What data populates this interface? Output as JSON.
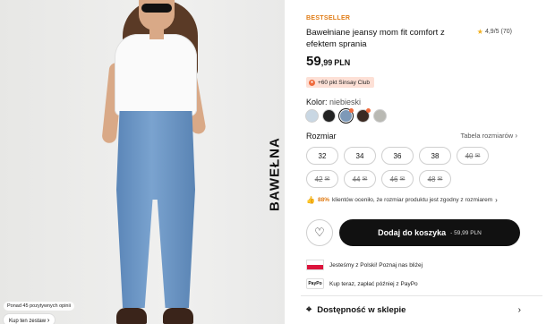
{
  "image": {
    "vertical_label": "BAWEŁNA",
    "reviews_note": "Ponad 45 pozytywnych opinii",
    "shop_look": "Kup ten zestaw",
    "shop_look_icon": "chevron-right-icon"
  },
  "product": {
    "badge": "BESTSELLER",
    "badge_color": "#e07b14",
    "title": "Bawełniane jeansy mom fit comfort z efektem sprania",
    "rating": "4,9/5",
    "rating_count": "(70)",
    "price_main": "59",
    "price_decimal": ",99",
    "currency": "PLN",
    "club_text": "+60 pkt Sinsay Club"
  },
  "color": {
    "label": "Kolor:",
    "value": "niebieski",
    "swatches": [
      {
        "name": "light-blue",
        "hex": "#c9d7e3",
        "selected": false,
        "dot": false
      },
      {
        "name": "black",
        "hex": "#222222",
        "selected": false,
        "dot": false
      },
      {
        "name": "blue",
        "hex": "#7d99b8",
        "selected": true,
        "dot": true
      },
      {
        "name": "dark-brown",
        "hex": "#3b2a22",
        "selected": false,
        "dot": true
      },
      {
        "name": "grey",
        "hex": "#b9b9b3",
        "selected": false,
        "dot": false
      }
    ]
  },
  "size": {
    "label": "Rozmiar",
    "guide": "Tabela rozmiarów",
    "options": [
      {
        "label": "32",
        "available": true
      },
      {
        "label": "34",
        "available": true
      },
      {
        "label": "36",
        "available": true
      },
      {
        "label": "38",
        "available": true
      },
      {
        "label": "40",
        "available": false
      },
      {
        "label": "42",
        "available": false
      },
      {
        "label": "44",
        "available": false
      },
      {
        "label": "46",
        "available": false
      },
      {
        "label": "48",
        "available": false
      }
    ]
  },
  "fit": {
    "percent": "88%",
    "text": "klientów oceniło, że rozmiar produktu jest zgodny z rozmiarem"
  },
  "actions": {
    "add_to_cart": "Dodaj do koszyka",
    "add_to_cart_price": "- 59,99 PLN"
  },
  "info": {
    "origin": "Jesteśmy z Polski! Poznaj nas bliżej",
    "paypo_logo": "PayPo",
    "paypo": "Kup teraz, zapłać później z PayPo"
  },
  "store": {
    "label": "Dostępność w sklepie"
  }
}
